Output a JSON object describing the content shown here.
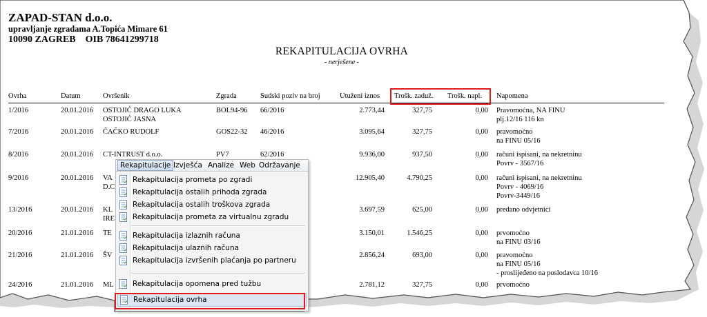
{
  "company": {
    "name": "ZAPAD-STAN d.o.o.",
    "subtitle": "upravljanje zgradama A.Topića Mimare 61",
    "address": "10090 ZAGREB    OIB 78641299718"
  },
  "report": {
    "title": "REKAPITULACIJA OVRHA",
    "subtitle": "- nerješene -"
  },
  "table": {
    "headers": {
      "ovrha": "Ovrha",
      "datum": "Datum",
      "ovrsenik": "Ovršenik",
      "zgrada": "Zgrada",
      "sudski": "Sudski poziv na broj",
      "utuzeni": "Utuženi iznos",
      "trosk_zaduz": "Trošk. zaduž.",
      "trosk_napl": "Trošk. napl.",
      "napomena": "Napomena"
    },
    "rows": [
      {
        "ovrha": "1/2016",
        "datum": "20.01.2016",
        "ovrsenik": "OSTOJIĆ  DRAGO LUKA",
        "ovrsenik2": "OSTOJIĆ JASNA",
        "zgrada": "BOL94-96",
        "sudski": "66/2016",
        "utuzeni": "2.773,44",
        "trosk_zaduz": "327,75",
        "trosk_napl": "0,00",
        "napomena": [
          "Pravomoćna, NA FINU",
          "plj.12/16  116 kn"
        ]
      },
      {
        "ovrha": "7/2016",
        "datum": "20.01.2016",
        "ovrsenik": "ČAČKO RUDOLF",
        "ovrsenik2": "",
        "zgrada": "GOS22-32",
        "sudski": "46/2016",
        "utuzeni": "3.095,64",
        "trosk_zaduz": "327,75",
        "trosk_napl": "0,00",
        "napomena": [
          "pravomoćno",
          "na FINU 05/16"
        ]
      },
      {
        "ovrha": "8/2016",
        "datum": "20.01.2016",
        "ovrsenik": "CT-INTRUST d.o.o.",
        "ovrsenik2": "",
        "zgrada": "PV7",
        "sudski": "62/2016",
        "utuzeni": "9.936,00",
        "trosk_zaduz": "937,50",
        "trosk_napl": "0,00",
        "napomena": [
          "računi ispisani, na nekretninu",
          "Povrv - 3567/16"
        ]
      },
      {
        "ovrha": "9/2016",
        "datum": "20.01.2016",
        "ovrsenik": "VA",
        "ovrsenik2": "D.C",
        "zgrada": "",
        "sudski": "",
        "utuzeni": "12.905,40",
        "trosk_zaduz": "4.790,25",
        "trosk_napl": "0,00",
        "napomena": [
          "računi ispisani, na nekretninu",
          "Povrv - 4069/16",
          "Povrv-3449/16"
        ]
      },
      {
        "ovrha": "13/2016",
        "datum": "20.01.2016",
        "ovrsenik": "KL",
        "ovrsenik2": "IRE",
        "zgrada": "",
        "sudski": "",
        "utuzeni": "3.697,59",
        "trosk_zaduz": "625,00",
        "trosk_napl": "0,00",
        "napomena": [
          "predano odvjetnici"
        ]
      },
      {
        "ovrha": "20/2016",
        "datum": "21.01.2016",
        "ovrsenik": "TE",
        "ovrsenik2": "",
        "zgrada": "",
        "sudski": "",
        "utuzeni": "3.150,01",
        "trosk_zaduz": "1.546,25",
        "trosk_napl": "0,00",
        "napomena": [
          "prvomoćno",
          "na FINU 03/16"
        ]
      },
      {
        "ovrha": "21/2016",
        "datum": "21.01.2016",
        "ovrsenik": "ŠV",
        "ovrsenik2": "",
        "zgrada": "",
        "sudski": "",
        "utuzeni": "2.856,24",
        "trosk_zaduz": "693,00",
        "trosk_napl": "0,00",
        "napomena": [
          "pravomoćno",
          "na FINU 05/16",
          "- proslijeđeno na poslodavca 10/16"
        ]
      },
      {
        "ovrha": "24/2016",
        "datum": "21.01.2016",
        "ovrsenik": "ML",
        "ovrsenik2": "",
        "zgrada": "",
        "sudski": "",
        "utuzeni": "2.781,12",
        "trosk_zaduz": "327,75",
        "trosk_napl": "0,00",
        "napomena": [
          "prvomoćno"
        ]
      }
    ]
  },
  "menu": {
    "bar": [
      "Rekapitulacije",
      "Izvješća",
      "Analize",
      "Web",
      "Održavanje"
    ],
    "items": [
      "Rekapitulacija prometa po zgradi",
      "Rekapitulacija ostalih prihoda zgrada",
      "Rekapitulacija ostalih troškova zgrada",
      "Rekapitulacija prometa za virtualnu zgradu",
      "Rekapitulacija izlaznih računa",
      "Rekapitulacija ulaznih računa",
      "Rekapitulacija izvršenih plaćanja po partneru",
      "Rekapitulacija opomena pred tužbu",
      "Rekapitulacija ovrha"
    ]
  },
  "colors": {
    "highlight": "#e01a1a",
    "menu_bg": "#f4f4f4",
    "menu_selected": "#dde6f2"
  }
}
